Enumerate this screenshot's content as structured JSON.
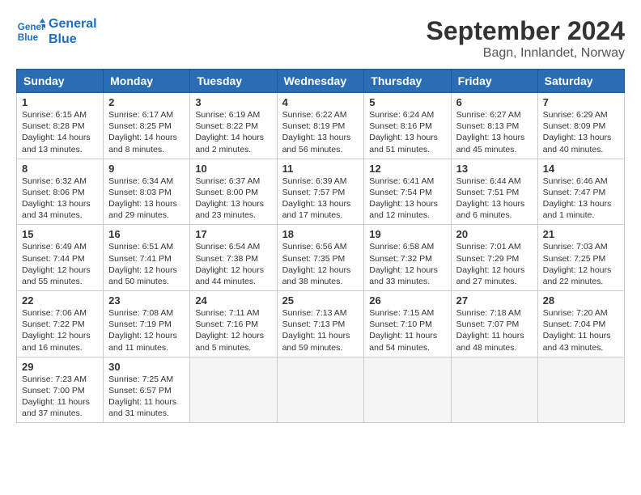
{
  "header": {
    "logo_line1": "General",
    "logo_line2": "Blue",
    "month_title": "September 2024",
    "location": "Bagn, Innlandet, Norway"
  },
  "weekdays": [
    "Sunday",
    "Monday",
    "Tuesday",
    "Wednesday",
    "Thursday",
    "Friday",
    "Saturday"
  ],
  "days": [
    {
      "num": "",
      "info": ""
    },
    {
      "num": "",
      "info": ""
    },
    {
      "num": "",
      "info": ""
    },
    {
      "num": "",
      "info": ""
    },
    {
      "num": "",
      "info": ""
    },
    {
      "num": "",
      "info": ""
    },
    {
      "num": "1",
      "sunrise": "Sunrise: 6:15 AM",
      "sunset": "Sunset: 8:28 PM",
      "daylight": "Daylight: 14 hours and 13 minutes."
    },
    {
      "num": "2",
      "sunrise": "Sunrise: 6:17 AM",
      "sunset": "Sunset: 8:25 PM",
      "daylight": "Daylight: 14 hours and 8 minutes."
    },
    {
      "num": "3",
      "sunrise": "Sunrise: 6:19 AM",
      "sunset": "Sunset: 8:22 PM",
      "daylight": "Daylight: 14 hours and 2 minutes."
    },
    {
      "num": "4",
      "sunrise": "Sunrise: 6:22 AM",
      "sunset": "Sunset: 8:19 PM",
      "daylight": "Daylight: 13 hours and 56 minutes."
    },
    {
      "num": "5",
      "sunrise": "Sunrise: 6:24 AM",
      "sunset": "Sunset: 8:16 PM",
      "daylight": "Daylight: 13 hours and 51 minutes."
    },
    {
      "num": "6",
      "sunrise": "Sunrise: 6:27 AM",
      "sunset": "Sunset: 8:13 PM",
      "daylight": "Daylight: 13 hours and 45 minutes."
    },
    {
      "num": "7",
      "sunrise": "Sunrise: 6:29 AM",
      "sunset": "Sunset: 8:09 PM",
      "daylight": "Daylight: 13 hours and 40 minutes."
    },
    {
      "num": "8",
      "sunrise": "Sunrise: 6:32 AM",
      "sunset": "Sunset: 8:06 PM",
      "daylight": "Daylight: 13 hours and 34 minutes."
    },
    {
      "num": "9",
      "sunrise": "Sunrise: 6:34 AM",
      "sunset": "Sunset: 8:03 PM",
      "daylight": "Daylight: 13 hours and 29 minutes."
    },
    {
      "num": "10",
      "sunrise": "Sunrise: 6:37 AM",
      "sunset": "Sunset: 8:00 PM",
      "daylight": "Daylight: 13 hours and 23 minutes."
    },
    {
      "num": "11",
      "sunrise": "Sunrise: 6:39 AM",
      "sunset": "Sunset: 7:57 PM",
      "daylight": "Daylight: 13 hours and 17 minutes."
    },
    {
      "num": "12",
      "sunrise": "Sunrise: 6:41 AM",
      "sunset": "Sunset: 7:54 PM",
      "daylight": "Daylight: 13 hours and 12 minutes."
    },
    {
      "num": "13",
      "sunrise": "Sunrise: 6:44 AM",
      "sunset": "Sunset: 7:51 PM",
      "daylight": "Daylight: 13 hours and 6 minutes."
    },
    {
      "num": "14",
      "sunrise": "Sunrise: 6:46 AM",
      "sunset": "Sunset: 7:47 PM",
      "daylight": "Daylight: 13 hours and 1 minute."
    },
    {
      "num": "15",
      "sunrise": "Sunrise: 6:49 AM",
      "sunset": "Sunset: 7:44 PM",
      "daylight": "Daylight: 12 hours and 55 minutes."
    },
    {
      "num": "16",
      "sunrise": "Sunrise: 6:51 AM",
      "sunset": "Sunset: 7:41 PM",
      "daylight": "Daylight: 12 hours and 50 minutes."
    },
    {
      "num": "17",
      "sunrise": "Sunrise: 6:54 AM",
      "sunset": "Sunset: 7:38 PM",
      "daylight": "Daylight: 12 hours and 44 minutes."
    },
    {
      "num": "18",
      "sunrise": "Sunrise: 6:56 AM",
      "sunset": "Sunset: 7:35 PM",
      "daylight": "Daylight: 12 hours and 38 minutes."
    },
    {
      "num": "19",
      "sunrise": "Sunrise: 6:58 AM",
      "sunset": "Sunset: 7:32 PM",
      "daylight": "Daylight: 12 hours and 33 minutes."
    },
    {
      "num": "20",
      "sunrise": "Sunrise: 7:01 AM",
      "sunset": "Sunset: 7:29 PM",
      "daylight": "Daylight: 12 hours and 27 minutes."
    },
    {
      "num": "21",
      "sunrise": "Sunrise: 7:03 AM",
      "sunset": "Sunset: 7:25 PM",
      "daylight": "Daylight: 12 hours and 22 minutes."
    },
    {
      "num": "22",
      "sunrise": "Sunrise: 7:06 AM",
      "sunset": "Sunset: 7:22 PM",
      "daylight": "Daylight: 12 hours and 16 minutes."
    },
    {
      "num": "23",
      "sunrise": "Sunrise: 7:08 AM",
      "sunset": "Sunset: 7:19 PM",
      "daylight": "Daylight: 12 hours and 11 minutes."
    },
    {
      "num": "24",
      "sunrise": "Sunrise: 7:11 AM",
      "sunset": "Sunset: 7:16 PM",
      "daylight": "Daylight: 12 hours and 5 minutes."
    },
    {
      "num": "25",
      "sunrise": "Sunrise: 7:13 AM",
      "sunset": "Sunset: 7:13 PM",
      "daylight": "Daylight: 11 hours and 59 minutes."
    },
    {
      "num": "26",
      "sunrise": "Sunrise: 7:15 AM",
      "sunset": "Sunset: 7:10 PM",
      "daylight": "Daylight: 11 hours and 54 minutes."
    },
    {
      "num": "27",
      "sunrise": "Sunrise: 7:18 AM",
      "sunset": "Sunset: 7:07 PM",
      "daylight": "Daylight: 11 hours and 48 minutes."
    },
    {
      "num": "28",
      "sunrise": "Sunrise: 7:20 AM",
      "sunset": "Sunset: 7:04 PM",
      "daylight": "Daylight: 11 hours and 43 minutes."
    },
    {
      "num": "29",
      "sunrise": "Sunrise: 7:23 AM",
      "sunset": "Sunset: 7:00 PM",
      "daylight": "Daylight: 11 hours and 37 minutes."
    },
    {
      "num": "30",
      "sunrise": "Sunrise: 7:25 AM",
      "sunset": "Sunset: 6:57 PM",
      "daylight": "Daylight: 11 hours and 31 minutes."
    },
    {
      "num": "",
      "info": ""
    },
    {
      "num": "",
      "info": ""
    },
    {
      "num": "",
      "info": ""
    },
    {
      "num": "",
      "info": ""
    },
    {
      "num": "",
      "info": ""
    }
  ]
}
